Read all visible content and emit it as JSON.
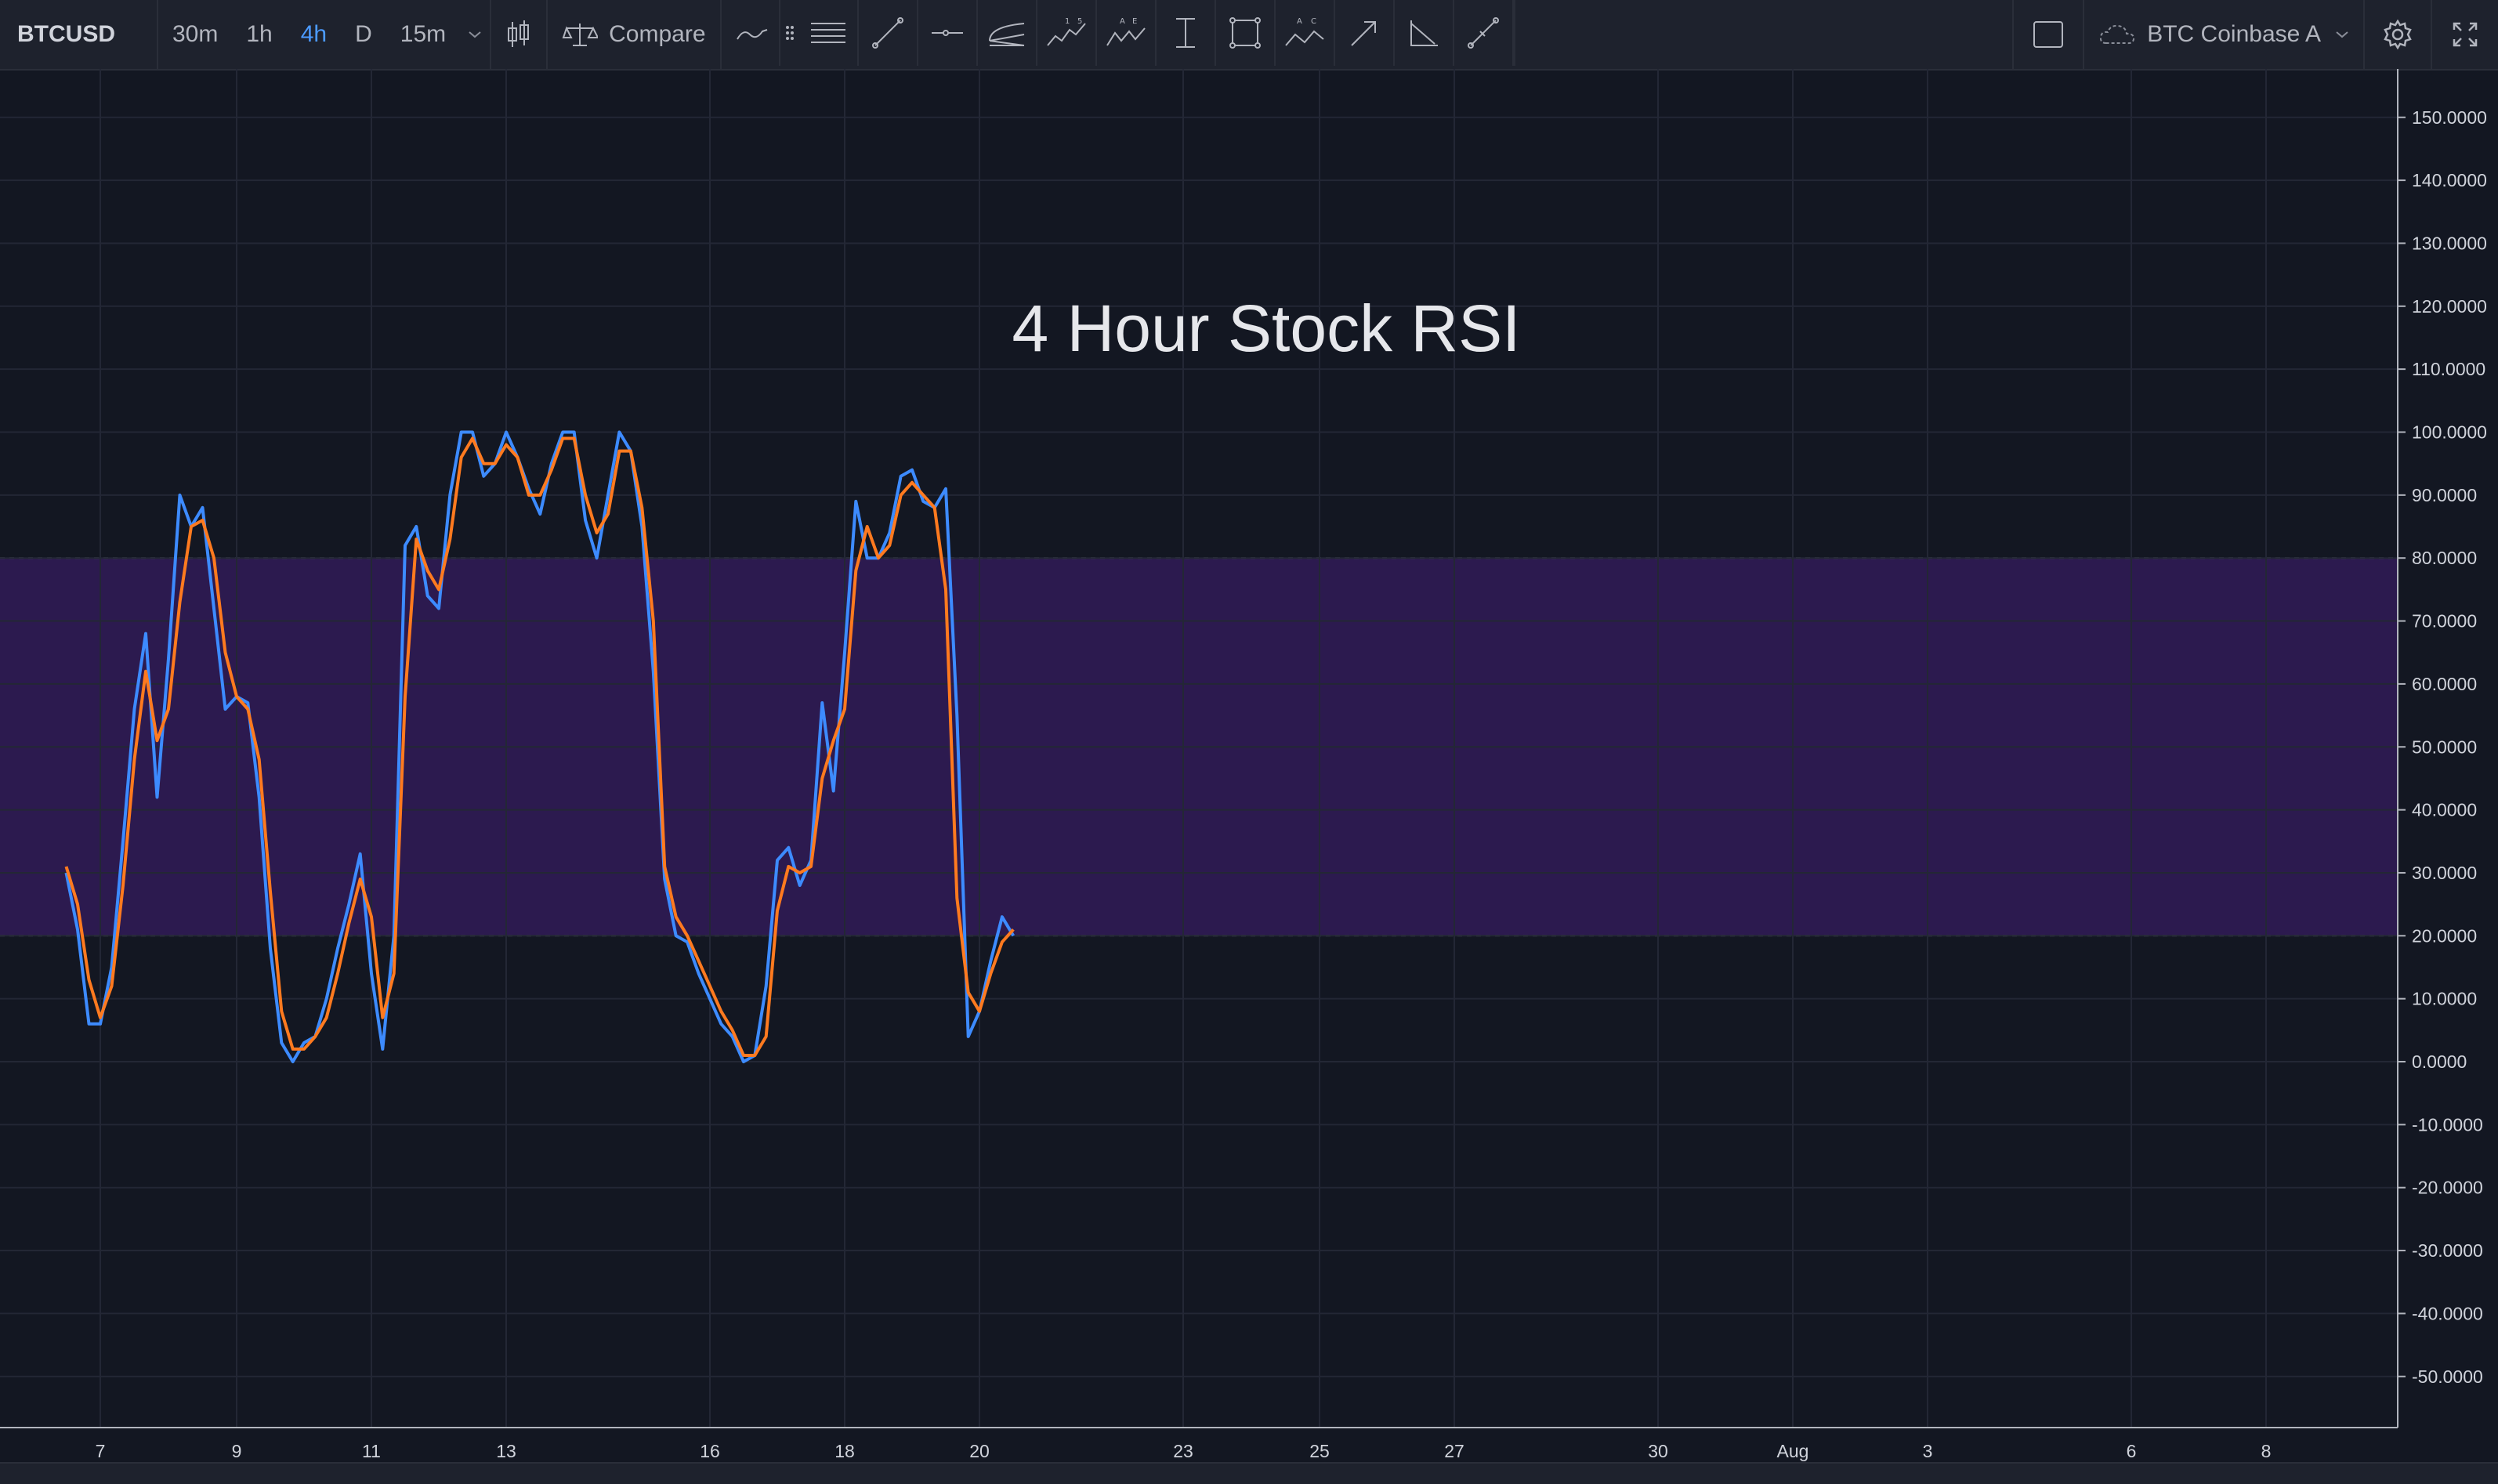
{
  "toolbar": {
    "symbol": "BTCUSD",
    "intervals": [
      "30m",
      "1h",
      "4h",
      "D",
      "15m"
    ],
    "active_interval": "4h",
    "compare_label": "Compare",
    "indicators_label": "In",
    "exchange_label": "BTC Coinbase A",
    "accent_color": "#4c9bff"
  },
  "drawing_tools": [
    "horizontal-lines-icon",
    "trend-line-icon",
    "horizontal-ray-icon",
    "pitchfork-icon",
    "elliott-wave-icon",
    "xabcd-pattern-icon",
    "price-range-icon",
    "rectangle-icon",
    "abcd-pattern-icon",
    "arrow-icon",
    "angle-icon",
    "ruler-icon"
  ],
  "chart_data": {
    "type": "line",
    "title": "4 Hour Stock RSI",
    "ylim": [
      -55,
      155
    ],
    "y_ticks": [
      "150.0000",
      "140.0000",
      "130.0000",
      "120.0000",
      "110.0000",
      "100.0000",
      "90.0000",
      "80.0000",
      "70.0000",
      "60.0000",
      "50.0000",
      "40.0000",
      "30.0000",
      "20.0000",
      "10.0000",
      "0.0000",
      "-10.0000",
      "-20.0000",
      "-30.0000",
      "-40.0000",
      "-50.0000"
    ],
    "x_ticks": [
      "7",
      "9",
      "11",
      "13",
      "16",
      "18",
      "20",
      "23",
      "25",
      "27",
      "30",
      "Aug",
      "3",
      "6",
      "8"
    ],
    "x_range": [
      "2018-07-06 12:00",
      "2018-08-09 00:00"
    ],
    "band": {
      "upper": 80,
      "lower": 20,
      "color": "#2c1a4f"
    },
    "grid": true,
    "series": [
      {
        "color": "#3d8bff",
        "points": [
          [
            "2018-07-06 12:00",
            30
          ],
          [
            "2018-07-06 16:00",
            21
          ],
          [
            "2018-07-06 20:00",
            6
          ],
          [
            "2018-07-07 00:00",
            6
          ],
          [
            "2018-07-07 04:00",
            15
          ],
          [
            "2018-07-07 08:00",
            35
          ],
          [
            "2018-07-07 12:00",
            56
          ],
          [
            "2018-07-07 16:00",
            68
          ],
          [
            "2018-07-07 20:00",
            42
          ],
          [
            "2018-07-08 00:00",
            64
          ],
          [
            "2018-07-08 04:00",
            90
          ],
          [
            "2018-07-08 08:00",
            85
          ],
          [
            "2018-07-08 12:00",
            88
          ],
          [
            "2018-07-08 16:00",
            72
          ],
          [
            "2018-07-08 20:00",
            56
          ],
          [
            "2018-07-09 00:00",
            58
          ],
          [
            "2018-07-09 04:00",
            57
          ],
          [
            "2018-07-09 08:00",
            42
          ],
          [
            "2018-07-09 12:00",
            18
          ],
          [
            "2018-07-09 16:00",
            3
          ],
          [
            "2018-07-09 20:00",
            0
          ],
          [
            "2018-07-10 00:00",
            3
          ],
          [
            "2018-07-10 04:00",
            4
          ],
          [
            "2018-07-10 08:00",
            10
          ],
          [
            "2018-07-10 12:00",
            18
          ],
          [
            "2018-07-10 16:00",
            25
          ],
          [
            "2018-07-10 20:00",
            33
          ],
          [
            "2018-07-11 00:00",
            14
          ],
          [
            "2018-07-11 04:00",
            2
          ],
          [
            "2018-07-11 08:00",
            20
          ],
          [
            "2018-07-11 12:00",
            82
          ],
          [
            "2018-07-11 16:00",
            85
          ],
          [
            "2018-07-11 20:00",
            74
          ],
          [
            "2018-07-12 00:00",
            72
          ],
          [
            "2018-07-12 04:00",
            90
          ],
          [
            "2018-07-12 08:00",
            100
          ],
          [
            "2018-07-12 12:00",
            100
          ],
          [
            "2018-07-12 16:00",
            93
          ],
          [
            "2018-07-12 20:00",
            95
          ],
          [
            "2018-07-13 00:00",
            100
          ],
          [
            "2018-07-13 04:00",
            96
          ],
          [
            "2018-07-13 08:00",
            91
          ],
          [
            "2018-07-13 12:00",
            87
          ],
          [
            "2018-07-13 16:00",
            95
          ],
          [
            "2018-07-13 20:00",
            100
          ],
          [
            "2018-07-14 00:00",
            100
          ],
          [
            "2018-07-14 04:00",
            86
          ],
          [
            "2018-07-14 08:00",
            80
          ],
          [
            "2018-07-14 12:00",
            90
          ],
          [
            "2018-07-14 16:00",
            100
          ],
          [
            "2018-07-14 20:00",
            97
          ],
          [
            "2018-07-15 00:00",
            85
          ],
          [
            "2018-07-15 04:00",
            62
          ],
          [
            "2018-07-15 08:00",
            29
          ],
          [
            "2018-07-15 12:00",
            20
          ],
          [
            "2018-07-15 16:00",
            19
          ],
          [
            "2018-07-15 20:00",
            14
          ],
          [
            "2018-07-16 00:00",
            10
          ],
          [
            "2018-07-16 04:00",
            6
          ],
          [
            "2018-07-16 08:00",
            4
          ],
          [
            "2018-07-16 12:00",
            0
          ],
          [
            "2018-07-16 16:00",
            1
          ],
          [
            "2018-07-16 20:00",
            12
          ],
          [
            "2018-07-17 00:00",
            32
          ],
          [
            "2018-07-17 04:00",
            34
          ],
          [
            "2018-07-17 08:00",
            28
          ],
          [
            "2018-07-17 12:00",
            32
          ],
          [
            "2018-07-17 16:00",
            57
          ],
          [
            "2018-07-17 20:00",
            43
          ],
          [
            "2018-07-18 00:00",
            65
          ],
          [
            "2018-07-18 04:00",
            89
          ],
          [
            "2018-07-18 08:00",
            80
          ],
          [
            "2018-07-18 12:00",
            80
          ],
          [
            "2018-07-18 16:00",
            84
          ],
          [
            "2018-07-18 20:00",
            93
          ],
          [
            "2018-07-19 00:00",
            94
          ],
          [
            "2018-07-19 04:00",
            89
          ],
          [
            "2018-07-19 08:00",
            88
          ],
          [
            "2018-07-19 12:00",
            91
          ],
          [
            "2018-07-19 16:00",
            55
          ],
          [
            "2018-07-19 20:00",
            4
          ],
          [
            "2018-07-20 00:00",
            8
          ],
          [
            "2018-07-20 04:00",
            16
          ],
          [
            "2018-07-20 08:00",
            23
          ],
          [
            "2018-07-20 12:00",
            20
          ]
        ]
      },
      {
        "color": "#ff7a1f",
        "points": [
          [
            "2018-07-06 12:00",
            31
          ],
          [
            "2018-07-06 16:00",
            25
          ],
          [
            "2018-07-06 20:00",
            13
          ],
          [
            "2018-07-07 00:00",
            7
          ],
          [
            "2018-07-07 04:00",
            12
          ],
          [
            "2018-07-07 08:00",
            28
          ],
          [
            "2018-07-07 12:00",
            48
          ],
          [
            "2018-07-07 16:00",
            62
          ],
          [
            "2018-07-07 20:00",
            51
          ],
          [
            "2018-07-08 00:00",
            56
          ],
          [
            "2018-07-08 04:00",
            73
          ],
          [
            "2018-07-08 08:00",
            85
          ],
          [
            "2018-07-08 12:00",
            86
          ],
          [
            "2018-07-08 16:00",
            80
          ],
          [
            "2018-07-08 20:00",
            65
          ],
          [
            "2018-07-09 00:00",
            58
          ],
          [
            "2018-07-09 04:00",
            56
          ],
          [
            "2018-07-09 08:00",
            48
          ],
          [
            "2018-07-09 12:00",
            27
          ],
          [
            "2018-07-09 16:00",
            8
          ],
          [
            "2018-07-09 20:00",
            2
          ],
          [
            "2018-07-10 00:00",
            2
          ],
          [
            "2018-07-10 04:00",
            4
          ],
          [
            "2018-07-10 08:00",
            7
          ],
          [
            "2018-07-10 12:00",
            14
          ],
          [
            "2018-07-10 16:00",
            22
          ],
          [
            "2018-07-10 20:00",
            29
          ],
          [
            "2018-07-11 00:00",
            23
          ],
          [
            "2018-07-11 04:00",
            7
          ],
          [
            "2018-07-11 08:00",
            14
          ],
          [
            "2018-07-11 12:00",
            58
          ],
          [
            "2018-07-11 16:00",
            83
          ],
          [
            "2018-07-11 20:00",
            78
          ],
          [
            "2018-07-12 00:00",
            75
          ],
          [
            "2018-07-12 04:00",
            83
          ],
          [
            "2018-07-12 08:00",
            96
          ],
          [
            "2018-07-12 12:00",
            99
          ],
          [
            "2018-07-12 16:00",
            95
          ],
          [
            "2018-07-12 20:00",
            95
          ],
          [
            "2018-07-13 00:00",
            98
          ],
          [
            "2018-07-13 04:00",
            96
          ],
          [
            "2018-07-13 08:00",
            90
          ],
          [
            "2018-07-13 12:00",
            90
          ],
          [
            "2018-07-13 16:00",
            94
          ],
          [
            "2018-07-13 20:00",
            99
          ],
          [
            "2018-07-14 00:00",
            99
          ],
          [
            "2018-07-14 04:00",
            90
          ],
          [
            "2018-07-14 08:00",
            84
          ],
          [
            "2018-07-14 12:00",
            87
          ],
          [
            "2018-07-14 16:00",
            97
          ],
          [
            "2018-07-14 20:00",
            97
          ],
          [
            "2018-07-15 00:00",
            88
          ],
          [
            "2018-07-15 04:00",
            70
          ],
          [
            "2018-07-15 08:00",
            31
          ],
          [
            "2018-07-15 12:00",
            23
          ],
          [
            "2018-07-15 16:00",
            20
          ],
          [
            "2018-07-15 20:00",
            16
          ],
          [
            "2018-07-16 00:00",
            12
          ],
          [
            "2018-07-16 04:00",
            8
          ],
          [
            "2018-07-16 08:00",
            5
          ],
          [
            "2018-07-16 12:00",
            1
          ],
          [
            "2018-07-16 16:00",
            1
          ],
          [
            "2018-07-16 20:00",
            4
          ],
          [
            "2018-07-17 00:00",
            24
          ],
          [
            "2018-07-17 04:00",
            31
          ],
          [
            "2018-07-17 08:00",
            30
          ],
          [
            "2018-07-17 12:00",
            31
          ],
          [
            "2018-07-17 16:00",
            45
          ],
          [
            "2018-07-17 20:00",
            51
          ],
          [
            "2018-07-18 00:00",
            56
          ],
          [
            "2018-07-18 04:00",
            78
          ],
          [
            "2018-07-18 08:00",
            85
          ],
          [
            "2018-07-18 12:00",
            80
          ],
          [
            "2018-07-18 16:00",
            82
          ],
          [
            "2018-07-18 20:00",
            90
          ],
          [
            "2018-07-19 00:00",
            92
          ],
          [
            "2018-07-19 04:00",
            90
          ],
          [
            "2018-07-19 08:00",
            88
          ],
          [
            "2018-07-19 12:00",
            75
          ],
          [
            "2018-07-19 16:00",
            26
          ],
          [
            "2018-07-19 20:00",
            11
          ],
          [
            "2018-07-20 00:00",
            8
          ],
          [
            "2018-07-20 04:00",
            14
          ],
          [
            "2018-07-20 08:00",
            19
          ],
          [
            "2018-07-20 12:00",
            21
          ]
        ]
      }
    ]
  }
}
